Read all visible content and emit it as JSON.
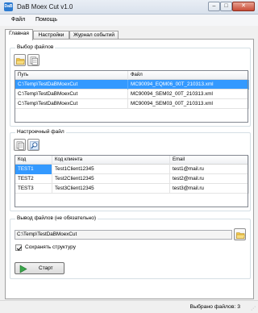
{
  "window": {
    "title": "DaB Moex Cut v1.0",
    "icon_text": "DaB"
  },
  "menu": {
    "items": [
      "Файл",
      "Помощь"
    ]
  },
  "tabs": [
    "Главная",
    "Настройки",
    "Журнал событий"
  ],
  "file_selection": {
    "label": "Выбор файлов",
    "columns": [
      "Путь",
      "Файл"
    ],
    "rows": [
      {
        "path": "C:\\Temp\\TestDaBMoexCut",
        "file": "MC90094_EQM06_00T_210313.xml"
      },
      {
        "path": "C:\\Temp\\TestDaBMoexCut",
        "file": "MC90094_SEM02_00T_210313.xml"
      },
      {
        "path": "C:\\Temp\\TestDaBMoexCut",
        "file": "MC90094_SEM03_00T_210313.xml"
      }
    ]
  },
  "settings_file": {
    "label": "Настроечный файл",
    "columns": [
      "Код",
      "Код клиента",
      "Email"
    ],
    "rows": [
      {
        "code": "TEST1",
        "client": "Test1Client12345",
        "email": "test1@mail.ru"
      },
      {
        "code": "TEST2",
        "client": "Test2Client12345",
        "email": "test2@mail.ru"
      },
      {
        "code": "TEST3",
        "client": "Test3Client12345",
        "email": "test3@mail.ru"
      }
    ]
  },
  "output": {
    "label": "Вывод файлов (не обязательно)",
    "path": "C:\\Temp\\TestDaBMoexCut",
    "keep_structure_label": "Сохранять структуру",
    "keep_structure_checked": true
  },
  "start_label": "Старт",
  "status": {
    "text": "Выбрано файлов: 3"
  }
}
